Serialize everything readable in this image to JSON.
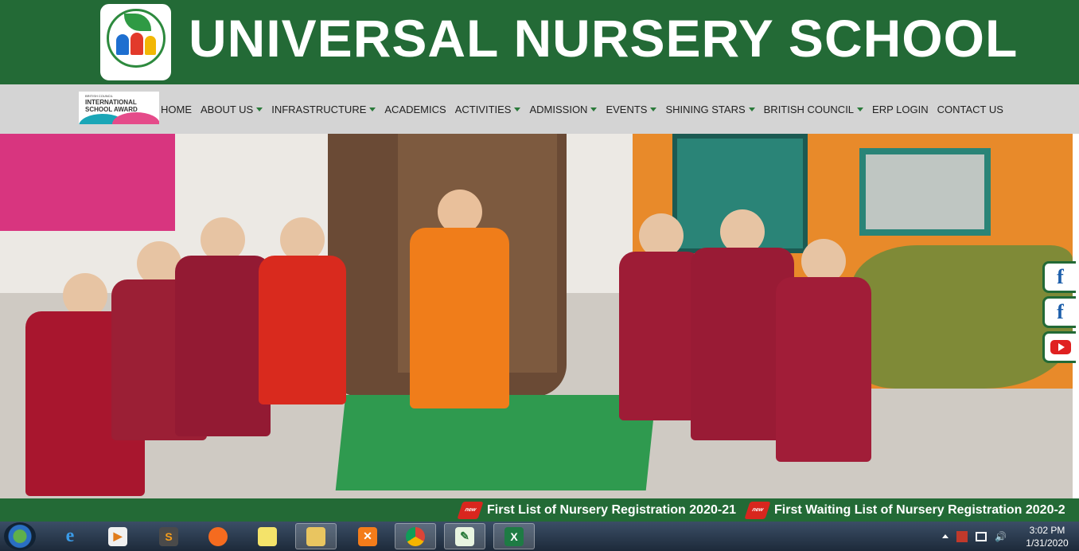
{
  "header": {
    "title": "UNIVERSAL NURSERY SCHOOL",
    "logo_text": "UNIVERSAL NURSERY SCHOOL"
  },
  "nav": {
    "award_top": "BRITISH COUNCIL",
    "award_title": "INTERNATIONAL SCHOOL AWARD",
    "items": [
      {
        "label": "HOME",
        "dropdown": false
      },
      {
        "label": "ABOUT US",
        "dropdown": true
      },
      {
        "label": "INFRASTRUCTURE",
        "dropdown": true
      },
      {
        "label": "ACADEMICS",
        "dropdown": false
      },
      {
        "label": "ACTIVITIES",
        "dropdown": true
      },
      {
        "label": "ADMISSION",
        "dropdown": true
      },
      {
        "label": "EVENTS",
        "dropdown": true
      },
      {
        "label": "SHINING STARS",
        "dropdown": true
      },
      {
        "label": "BRITISH COUNCIL",
        "dropdown": true
      },
      {
        "label": "ERP LOGIN",
        "dropdown": false
      },
      {
        "label": "CONTACT US",
        "dropdown": false
      }
    ]
  },
  "social": {
    "facebook1_icon": "facebook-icon",
    "facebook2_icon": "facebook-icon",
    "youtube_icon": "youtube-icon"
  },
  "ticker": {
    "items": [
      "First List of Nursery Registration 2020-21",
      "First Waiting List of Nursery Registration 2020-2"
    ],
    "badge": "new"
  },
  "taskbar": {
    "apps": [
      "internet-explorer-icon",
      "media-player-icon",
      "sublime-text-icon",
      "firefox-icon",
      "sticky-notes-icon",
      "file-explorer-icon",
      "xampp-icon",
      "chrome-icon",
      "notepad-plus-plus-icon",
      "excel-icon"
    ],
    "time": "3:02 PM",
    "date": "1/31/2020"
  },
  "colors": {
    "brand_green": "#236a36",
    "nav_bg": "#d4d4d4",
    "caret": "#2a7a3a"
  }
}
